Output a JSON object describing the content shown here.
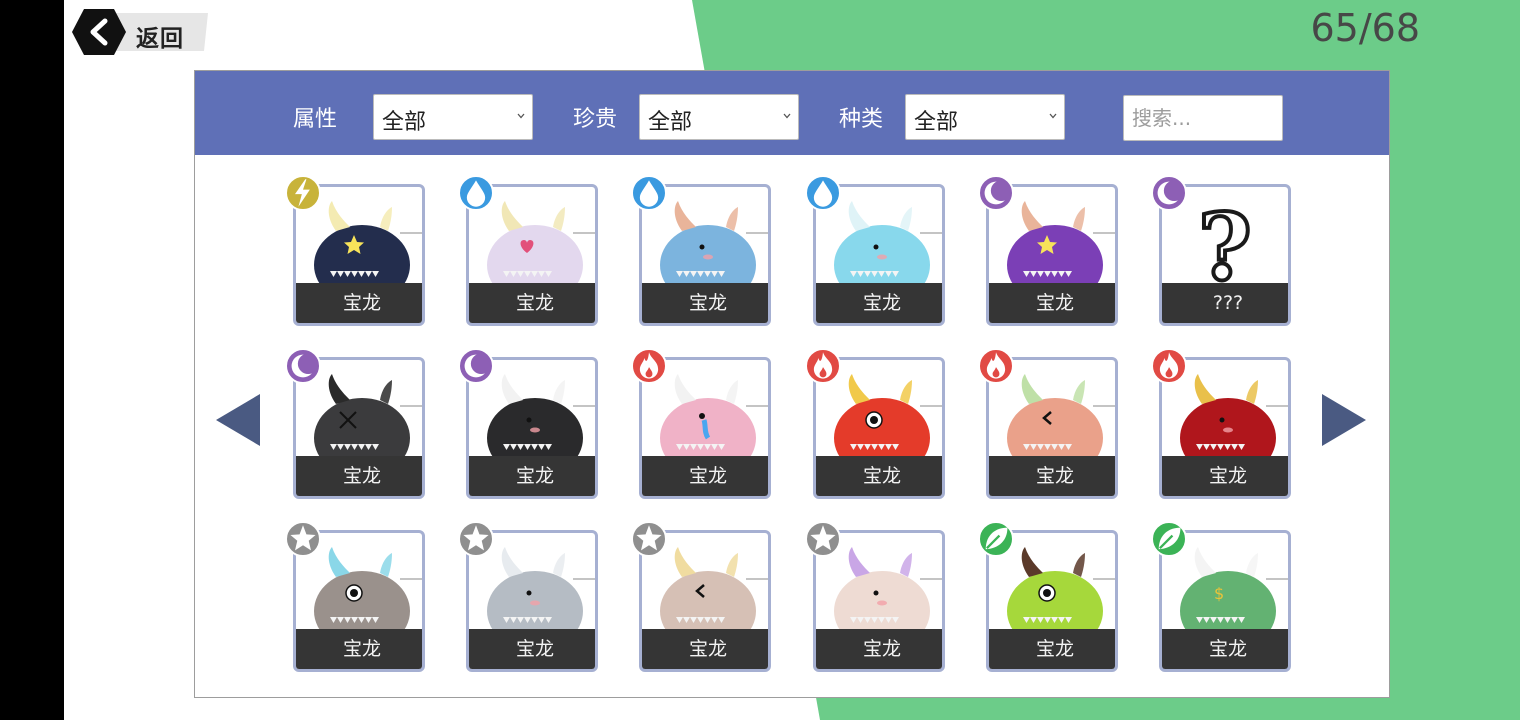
{
  "header": {
    "back_label": "返回",
    "counter": "65/68"
  },
  "filters": {
    "attribute": {
      "label": "属性",
      "value": "全部"
    },
    "rarity": {
      "label": "珍贵",
      "value": "全部"
    },
    "kind": {
      "label": "种类",
      "value": "全部"
    },
    "search_placeholder": "搜索..."
  },
  "colors": {
    "green_bg": "#6ccc89",
    "filter_bar": "#5f70b7",
    "arrow": "#4a5a82",
    "thunder": "#c8b33a",
    "water": "#3a9ae0",
    "dark": "#8d5fb5",
    "fire": "#e14a44",
    "normal": "#8f8f8f",
    "grass": "#3bb356"
  },
  "collection": {
    "cards": [
      {
        "name": "宝龙",
        "element": "thunder",
        "element_icon": "lightning-icon",
        "body_color": "#232d4d",
        "horn_color": "#f4ebb2",
        "face": "star"
      },
      {
        "name": "宝龙",
        "element": "water",
        "element_icon": "water-drop-icon",
        "body_color": "#e3d8ee",
        "horn_color": "#f1e7b6",
        "face": "heart"
      },
      {
        "name": "宝龙",
        "element": "water",
        "element_icon": "water-drop-icon",
        "body_color": "#7cb4de",
        "horn_color": "#e9b49a",
        "face": "dot"
      },
      {
        "name": "宝龙",
        "element": "water",
        "element_icon": "water-drop-icon",
        "body_color": "#88d8ec",
        "horn_color": "#dff3f7",
        "face": "dot"
      },
      {
        "name": "宝龙",
        "element": "dark",
        "element_icon": "crescent-moon-icon",
        "body_color": "#7b3fb6",
        "horn_color": "#e9b49a",
        "face": "star"
      },
      {
        "name": "???",
        "element": "dark",
        "element_icon": "crescent-moon-icon",
        "body_color": "",
        "horn_color": "",
        "face": "unknown"
      },
      {
        "name": "宝龙",
        "element": "dark",
        "element_icon": "crescent-moon-icon",
        "body_color": "#3b3b3d",
        "horn_color": "#2a2a2a",
        "face": "cross"
      },
      {
        "name": "宝龙",
        "element": "dark",
        "element_icon": "crescent-moon-icon",
        "body_color": "#2a2a2c",
        "horn_color": "#f2f2f2",
        "face": "dot"
      },
      {
        "name": "宝龙",
        "element": "fire",
        "element_icon": "flame-icon",
        "body_color": "#f0b2c7",
        "horn_color": "#f2f2f2",
        "face": "cry"
      },
      {
        "name": "宝龙",
        "element": "fire",
        "element_icon": "flame-icon",
        "body_color": "#e43b2a",
        "horn_color": "#f1c94a",
        "face": "eye"
      },
      {
        "name": "宝龙",
        "element": "fire",
        "element_icon": "flame-icon",
        "body_color": "#eaa18a",
        "horn_color": "#bfe0a7",
        "face": "angle"
      },
      {
        "name": "宝龙",
        "element": "fire",
        "element_icon": "flame-icon",
        "body_color": "#b0161c",
        "horn_color": "#e9c04a",
        "face": "dot"
      },
      {
        "name": "宝龙",
        "element": "normal",
        "element_icon": "star-icon",
        "body_color": "#9a918c",
        "horn_color": "#8ad7e8",
        "face": "eye"
      },
      {
        "name": "宝龙",
        "element": "normal",
        "element_icon": "star-icon",
        "body_color": "#b5bcc4",
        "horn_color": "#e7ebef",
        "face": "dot"
      },
      {
        "name": "宝龙",
        "element": "normal",
        "element_icon": "star-icon",
        "body_color": "#d6c0b5",
        "horn_color": "#f0dca0",
        "face": "angle"
      },
      {
        "name": "宝龙",
        "element": "normal",
        "element_icon": "star-icon",
        "body_color": "#eedbd3",
        "horn_color": "#c9a6e6",
        "face": "dot"
      },
      {
        "name": "宝龙",
        "element": "grass",
        "element_icon": "leaf-icon",
        "body_color": "#a6d83b",
        "horn_color": "#5b3a2a",
        "face": "eye"
      },
      {
        "name": "宝龙",
        "element": "grass",
        "element_icon": "leaf-icon",
        "body_color": "#63b272",
        "horn_color": "#f4f4f4",
        "face": "dollar"
      }
    ]
  }
}
